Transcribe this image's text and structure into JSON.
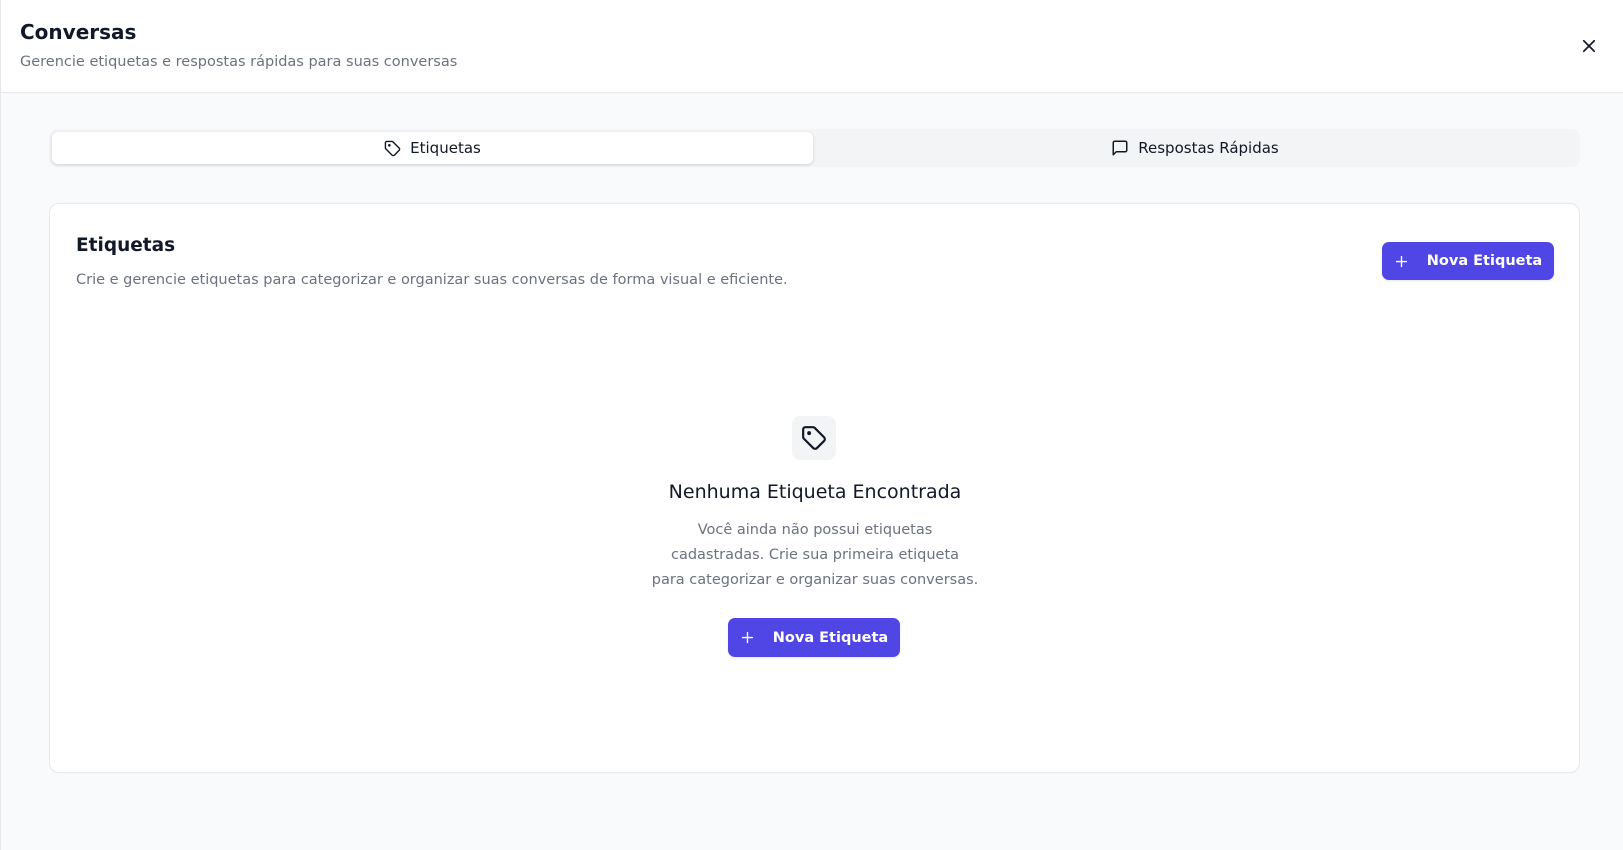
{
  "header": {
    "title": "Conversas",
    "subtitle": "Gerencie etiquetas e respostas rápidas para suas conversas",
    "close_icon": "close-icon"
  },
  "tabs": [
    {
      "label": "Etiquetas",
      "icon": "tag-icon",
      "active": true
    },
    {
      "label": "Respostas Rápidas",
      "icon": "message-square-icon",
      "active": false
    }
  ],
  "card": {
    "title": "Etiquetas",
    "description": "Crie e gerencie etiquetas para categorizar e organizar suas conversas de forma visual e eficiente.",
    "new_button_label": "Nova Etiqueta"
  },
  "empty_state": {
    "icon": "tag-icon",
    "title": "Nenhuma Etiqueta Encontrada",
    "description_lines": [
      "Você ainda não possui etiquetas",
      "cadastradas. Crie sua primeira etiqueta",
      "para categorizar e organizar suas conversas."
    ],
    "button_label": "Nova Etiqueta"
  },
  "colors": {
    "accent": "#4f46e5",
    "muted_text": "#6b7280",
    "border": "#e5e7eb"
  }
}
